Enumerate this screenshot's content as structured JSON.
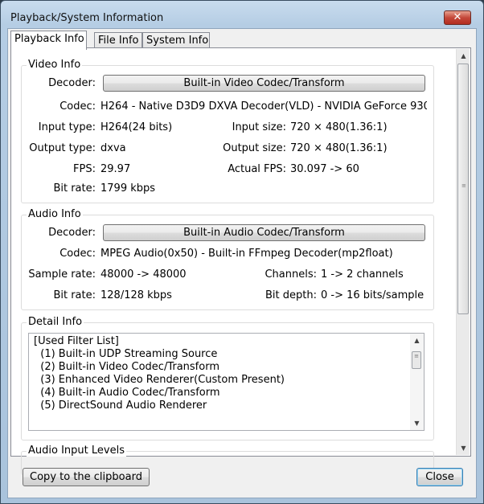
{
  "window": {
    "title": "Playback/System Information",
    "close_glyph": "✕"
  },
  "tabs": [
    "Playback Info",
    "File Info",
    "System Info"
  ],
  "video_info": {
    "title": "Video Info",
    "decoder_label": "Decoder:",
    "decoder_button": "Built-in Video Codec/Transform",
    "codec_label": "Codec:",
    "codec_value": "H264 - Native D3D9 DXVA Decoder(VLD) - NVIDIA GeForce 930",
    "input_type_label": "Input type:",
    "input_type_value": "H264(24 bits)",
    "input_size_label": "Input size:",
    "input_size_value": "720 × 480(1.36:1)",
    "output_type_label": "Output type:",
    "output_type_value": "dxva",
    "output_size_label": "Output size:",
    "output_size_value": "720 × 480(1.36:1)",
    "fps_label": "FPS:",
    "fps_value": "29.97",
    "actual_fps_label": "Actual FPS:",
    "actual_fps_value": "30.097 -> 60",
    "bitrate_label": "Bit rate:",
    "bitrate_value": "1799 kbps"
  },
  "audio_info": {
    "title": "Audio Info",
    "decoder_label": "Decoder:",
    "decoder_button": "Built-in Audio Codec/Transform",
    "codec_label": "Codec:",
    "codec_value": "MPEG Audio(0x50) - Built-in FFmpeg Decoder(mp2float)",
    "sample_rate_label": "Sample rate:",
    "sample_rate_value": "48000 -> 48000",
    "channels_label": "Channels:",
    "channels_value": "1 -> 2 channels",
    "bitrate_label": "Bit rate:",
    "bitrate_value": "128/128 kbps",
    "bit_depth_label": "Bit depth:",
    "bit_depth_value": "0 -> 16 bits/sample"
  },
  "detail_info": {
    "title": "Detail Info",
    "lines": [
      "[Used Filter List]",
      "  (1) Built-in UDP Streaming Source",
      "  (2) Built-in Video Codec/Transform",
      "  (3) Enhanced Video Renderer(Custom Present)",
      "  (4) Built-in Audio Codec/Transform",
      "  (5) DirectSound Audio Renderer"
    ]
  },
  "audio_input_levels": {
    "title": "Audio Input Levels"
  },
  "footer": {
    "copy_button": "Copy to the clipboard",
    "close_button": "Close"
  }
}
